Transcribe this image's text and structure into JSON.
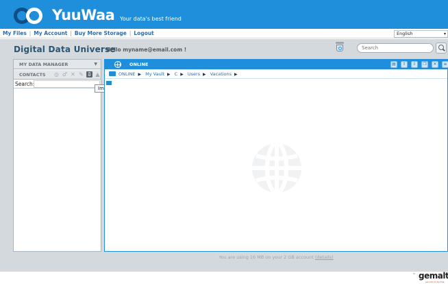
{
  "header": {
    "brand": "YuuWaa",
    "tagline": "Your data's best friend"
  },
  "topnav": {
    "links": [
      "My Files",
      "My Account",
      "Buy More Storage",
      "Logout"
    ],
    "language": "English"
  },
  "subheader": {
    "title": "Digital Data Universe",
    "greeting": "Hello myname@email.com !",
    "search_placeholder": "Search"
  },
  "left_panel": {
    "section1": "MY DATA MANAGER",
    "section2": "CONTACTS",
    "search_label": "Search:",
    "tooltip": "Import Contacts"
  },
  "right_panel": {
    "title": "ONLINE",
    "breadcrumb": [
      "ONLINE",
      "My Vault",
      "C",
      "Users",
      "Vacations"
    ]
  },
  "status": {
    "text": "You are using 16 MB on your 2 GB account",
    "details_link": "(details)"
  },
  "footer": {
    "logo": "gemalto",
    "tm": "™",
    "sub": "security to be free"
  },
  "colors": {
    "brand_blue": "#1f8fdc",
    "panel_gray": "#d4d9de"
  }
}
